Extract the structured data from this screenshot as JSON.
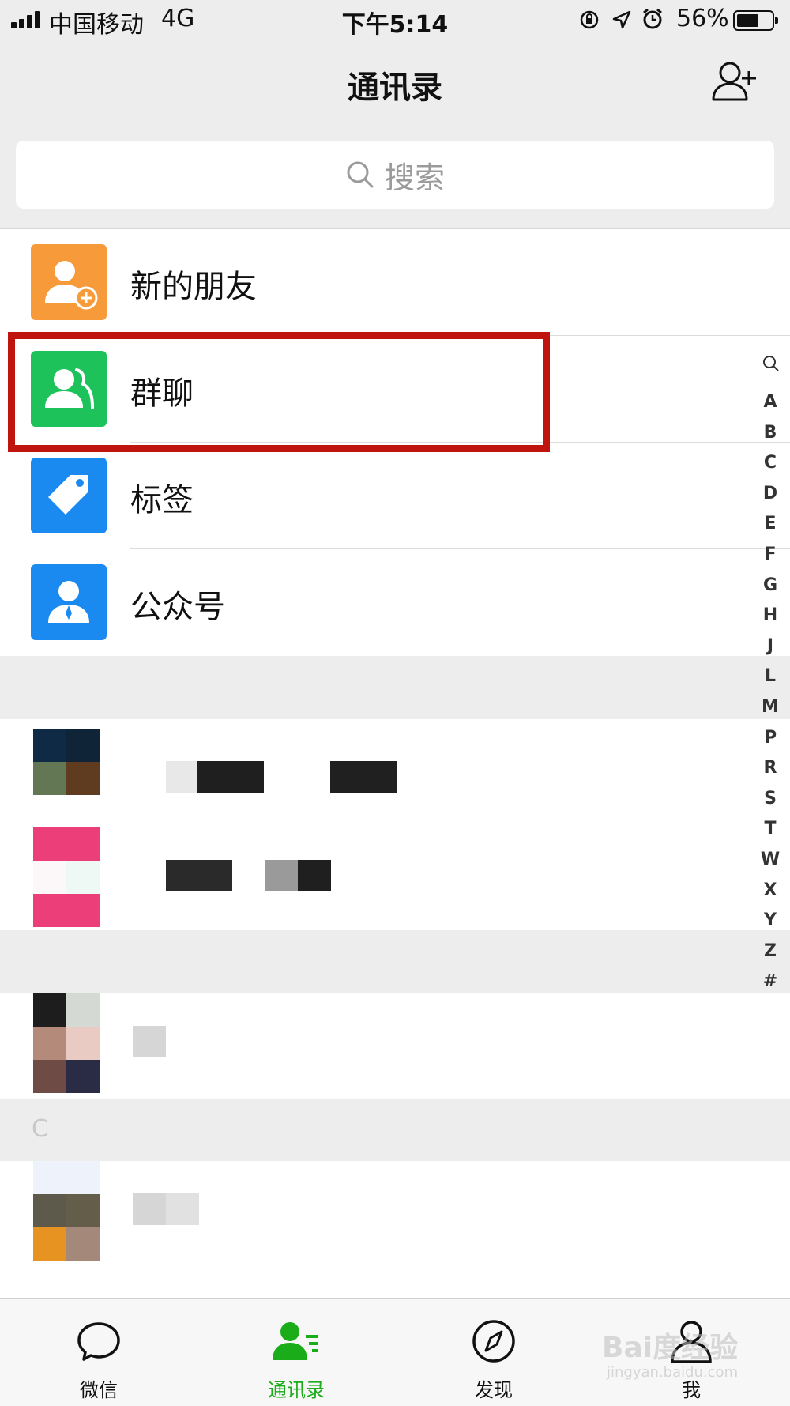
{
  "status_bar": {
    "carrier": "中国移动",
    "network": "4G",
    "time": "下午5:14",
    "battery_percent": "56%",
    "battery_level": 0.56
  },
  "nav": {
    "title": "通讯录",
    "add_contact_icon": "add-contact-icon"
  },
  "search": {
    "placeholder": "搜索",
    "icon": "search-icon"
  },
  "functions": [
    {
      "label": "新的朋友",
      "icon": "new-friend-icon",
      "color": "#f79a3a"
    },
    {
      "label": "群聊",
      "icon": "group-chat-icon",
      "color": "#1ec25a"
    },
    {
      "label": "标签",
      "icon": "tag-icon",
      "color": "#1b8af0"
    },
    {
      "label": "公众号",
      "icon": "official-account-icon",
      "color": "#1b8af0"
    }
  ],
  "sections": [
    {
      "letter": ""
    },
    {
      "letter": ""
    },
    {
      "letter": "C"
    }
  ],
  "index": [
    "A",
    "B",
    "C",
    "D",
    "E",
    "F",
    "G",
    "H",
    "J",
    "L",
    "M",
    "P",
    "R",
    "S",
    "T",
    "W",
    "X",
    "Y",
    "Z",
    "#"
  ],
  "tabs": [
    {
      "label": "微信",
      "icon": "chat-bubble-icon"
    },
    {
      "label": "通讯录",
      "icon": "contacts-icon",
      "active": true
    },
    {
      "label": "发现",
      "icon": "compass-icon"
    },
    {
      "label": "我",
      "icon": "person-icon"
    }
  ],
  "watermark": {
    "text": "Bai度经验",
    "sub": "jingyan.baidu.com"
  },
  "colors": {
    "accent_green": "#1aad19",
    "highlight_red": "#c0150e"
  }
}
